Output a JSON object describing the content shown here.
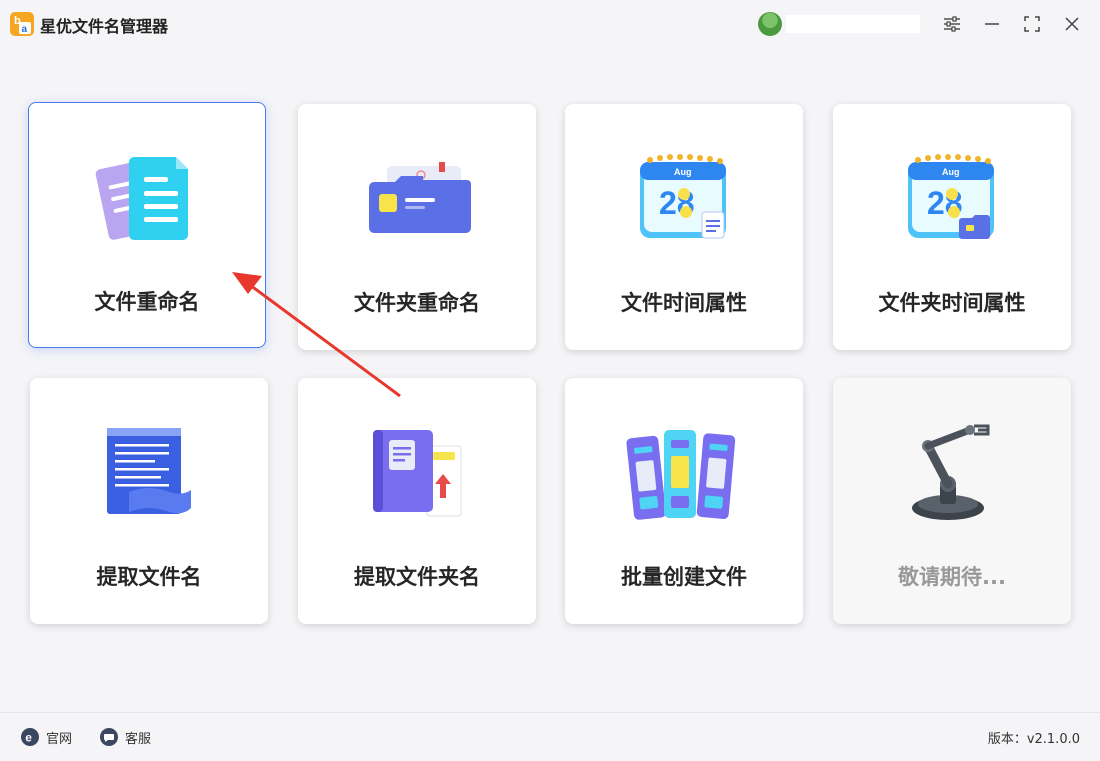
{
  "app": {
    "title": "星优文件名管理器"
  },
  "cards": [
    {
      "label": "文件重命名"
    },
    {
      "label": "文件夹重命名"
    },
    {
      "label": "文件时间属性"
    },
    {
      "label": "文件夹时间属性"
    },
    {
      "label": "提取文件名"
    },
    {
      "label": "提取文件夹名"
    },
    {
      "label": "批量创建文件"
    },
    {
      "label": "敬请期待..."
    }
  ],
  "calendar": {
    "month": "Aug",
    "day": "28"
  },
  "footer": {
    "website_label": "官网",
    "support_label": "客服",
    "version": "版本：v2.1.0.0"
  },
  "colors": {
    "accent": "#4a7cf0",
    "arrow": "#e8372c",
    "logo": "#f5a623"
  },
  "icons": [
    "app-logo-icon",
    "settings-icon",
    "minimize-icon",
    "maximize-icon",
    "close-icon",
    "website-icon",
    "support-icon"
  ]
}
